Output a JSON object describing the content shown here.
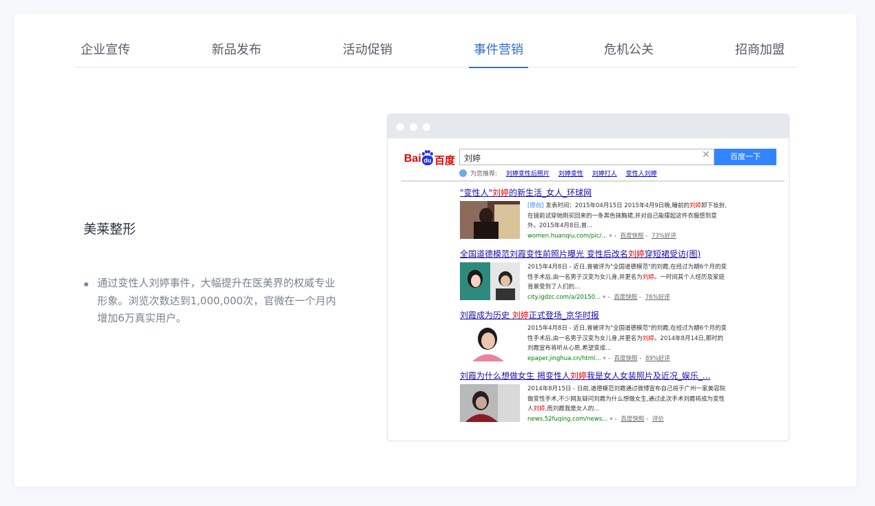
{
  "tabs": [
    {
      "label": "企业宣传",
      "active": false
    },
    {
      "label": "新品发布",
      "active": false
    },
    {
      "label": "活动促销",
      "active": false
    },
    {
      "label": "事件营销",
      "active": true
    },
    {
      "label": "危机公关",
      "active": false
    },
    {
      "label": "招商加盟",
      "active": false
    }
  ],
  "case": {
    "title": "美莱整形",
    "description": "通过变性人刘婷事件，大幅提升在医美界的权威专业形象。浏览次数达到1,000,000次，官微在一个月内增加6万真实用户。"
  },
  "baidu": {
    "logo_bai": "Bai",
    "logo_du": "du",
    "logo_cn": "百度",
    "query": "刘婷",
    "search_button": "百度一下",
    "suggest_label": "为您推荐:",
    "suggestions": [
      "刘婷变性后照片",
      "刘婷变性",
      "刘婷打人",
      "变性人刘婷"
    ],
    "results": [
      {
        "title_pre": "\"变性人\"",
        "title_em": "刘婷",
        "title_post": "的新生活_女人_环球网",
        "tag": "[原创]",
        "abs_pre": " 发表时间：2015年04月15日 2015年4月9日晚,睡前的",
        "abs_em": "刘婷",
        "abs_post": "卸下妆扮,在镜前试穿她刚买回来的一条黑色抹胸裙,并对自己能撑起这件衣服感到意外。2015年4月8日,曾...",
        "url": "women.huanqiu.com/pic/...",
        "cache": "百度快照",
        "extra": "73%好评"
      },
      {
        "title_pre": "全国道德模范刘霞变性前照片曝光 变性后改名",
        "title_em": "刘婷",
        "title_post": "穿短裙受访(图)",
        "tag": "",
        "abs_pre": "2015年4月8日 - 近日,曾被评为\"全国道德模范\"的刘霞,在经过为期6个月的变性手术后,由一名男子汉变为女儿身,并更名为",
        "abs_em": "刘婷",
        "abs_post": "。一时间其个人经历及家庭背景受到了人们的...",
        "url": "city.igdzc.com/a/20150...",
        "cache": "百度快照",
        "extra": "76%好评"
      },
      {
        "title_pre": "刘霞成为历史 ",
        "title_em": "刘婷",
        "title_post": "正式登场_京华时报",
        "tag": "",
        "abs_pre": "2015年4月8日 - 近日,曾被评为\"全国道德模范\"的刘霞,在经过为期6个月的变性手术后,由一名男子汉变为女儿身,并更名为",
        "abs_em": "刘婷",
        "abs_post": "。2014年8月14日,那时的刘霞宣布将听从心愿,希望变成...",
        "url": "epaper.jinghua.cn/html...",
        "cache": "百度快照",
        "extra": "89%好评"
      },
      {
        "title_pre": "刘霞为什么想做女生 揭变性人",
        "title_em": "刘婷",
        "title_post": "我是女人女装照片及近况_娱乐_...",
        "tag": "",
        "abs_pre": "2014年8月15日 - 日前,道德模范刘霞通过微博宣布自己将于广州一家美容院做变性手术,不少网友疑问刘霞为什么想做女生,通过此次手术刘霞将成为变性人",
        "abs_em": "刘婷",
        "abs_post": ",而刘霞我是女人的...",
        "url": "news.52fuqing.com/news...",
        "cache": "百度快照",
        "extra": "评价"
      }
    ]
  },
  "colors": {
    "accent": "#2f6fd0",
    "baidu_red": "#e10601",
    "baidu_blue": "#3385ff"
  }
}
